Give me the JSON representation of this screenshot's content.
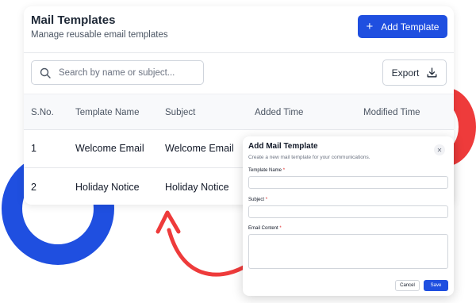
{
  "header": {
    "title": "Mail Templates",
    "subtitle": "Manage reusable email templates",
    "add_label": "Add Template"
  },
  "search": {
    "placeholder": "Search by name or subject..."
  },
  "export": {
    "label": "Export"
  },
  "table": {
    "columns": [
      "S.No.",
      "Template Name",
      "Subject",
      "Added Time",
      "Modified Time"
    ],
    "rows": [
      {
        "sno": "1",
        "name": "Welcome Email",
        "subject": "Welcome Email"
      },
      {
        "sno": "2",
        "name": "Holiday Notice",
        "subject": "Holiday Notice"
      }
    ]
  },
  "modal": {
    "title": "Add Mail Template",
    "subtitle": "Create a new mail template for your communications.",
    "close_icon": "close-icon",
    "fields": {
      "template_name": "Template Name",
      "subject": "Subject",
      "content": "Email Content",
      "required_mark": "*"
    },
    "cancel_label": "Cancel",
    "save_label": "Save"
  },
  "colors": {
    "primary": "#1f4fe0",
    "accent_red": "#ee3b3b"
  }
}
